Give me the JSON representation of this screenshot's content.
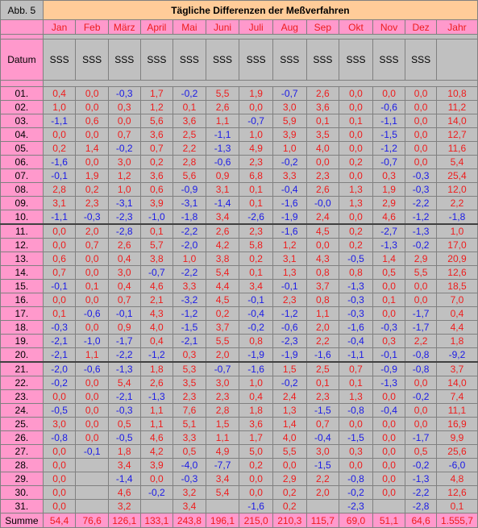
{
  "abb_label": "Abb. 5",
  "title": "Tägliche Differenzen der Meßverfahren",
  "months": [
    "Jan",
    "Feb",
    "März",
    "April",
    "Mai",
    "Juni",
    "Juli",
    "Aug",
    "Sep",
    "Okt",
    "Nov",
    "Dez",
    "Jahr"
  ],
  "datum_label": "Datum",
  "sss_values": [
    "SSS",
    "SSS",
    "SSS",
    "SSS",
    "SSS",
    "SSS",
    "SSS",
    "SSS",
    "SSS",
    "SSS",
    "SSS",
    "SSS",
    ""
  ],
  "rows": [
    {
      "day": "01.",
      "v": [
        "0,4",
        "0,0",
        "-0,3",
        "1,7",
        "-0,2",
        "5,5",
        "1,9",
        "-0,7",
        "2,6",
        "0,0",
        "0,0",
        "0,0",
        "10,8"
      ]
    },
    {
      "day": "02.",
      "v": [
        "1,0",
        "0,0",
        "0,3",
        "1,2",
        "0,1",
        "2,6",
        "0,0",
        "3,0",
        "3,6",
        "0,0",
        "-0,6",
        "0,0",
        "11,2"
      ]
    },
    {
      "day": "03.",
      "v": [
        "-1,1",
        "0,6",
        "0,0",
        "5,6",
        "3,6",
        "1,1",
        "-0,7",
        "5,9",
        "0,1",
        "0,1",
        "-1,1",
        "0,0",
        "14,0"
      ]
    },
    {
      "day": "04.",
      "v": [
        "0,0",
        "0,0",
        "0,7",
        "3,6",
        "2,5",
        "-1,1",
        "1,0",
        "3,9",
        "3,5",
        "0,0",
        "-1,5",
        "0,0",
        "12,7"
      ]
    },
    {
      "day": "05.",
      "v": [
        "0,2",
        "1,4",
        "-0,2",
        "0,7",
        "2,2",
        "-1,3",
        "4,9",
        "1,0",
        "4,0",
        "0,0",
        "-1,2",
        "0,0",
        "11,6"
      ]
    },
    {
      "day": "06.",
      "v": [
        "-1,6",
        "0,0",
        "3,0",
        "0,2",
        "2,8",
        "-0,6",
        "2,3",
        "-0,2",
        "0,0",
        "0,2",
        "-0,7",
        "0,0",
        "5,4"
      ]
    },
    {
      "day": "07.",
      "v": [
        "-0,1",
        "1,9",
        "1,2",
        "3,6",
        "5,6",
        "0,9",
        "6,8",
        "3,3",
        "2,3",
        "0,0",
        "0,3",
        "-0,3",
        "25,4"
      ]
    },
    {
      "day": "08.",
      "v": [
        "2,8",
        "0,2",
        "1,0",
        "0,6",
        "-0,9",
        "3,1",
        "0,1",
        "-0,4",
        "2,6",
        "1,3",
        "1,9",
        "-0,3",
        "12,0"
      ]
    },
    {
      "day": "09.",
      "v": [
        "3,1",
        "2,3",
        "-3,1",
        "3,9",
        "-3,1",
        "-1,4",
        "0,1",
        "-1,6",
        "-0,0",
        "1,3",
        "2,9",
        "-2,2",
        "2,2"
      ]
    },
    {
      "day": "10.",
      "v": [
        "-1,1",
        "-0,3",
        "-2,3",
        "-1,0",
        "-1,8",
        "3,4",
        "-2,6",
        "-1,9",
        "2,4",
        "0,0",
        "4,6",
        "-1,2",
        "-1,8"
      ]
    },
    {
      "day": "11.",
      "v": [
        "0,0",
        "2,0",
        "-2,8",
        "0,1",
        "-2,2",
        "2,6",
        "2,3",
        "-1,6",
        "4,5",
        "0,2",
        "-2,7",
        "-1,3",
        "1,0"
      ]
    },
    {
      "day": "12.",
      "v": [
        "0,0",
        "0,7",
        "2,6",
        "5,7",
        "-2,0",
        "4,2",
        "5,8",
        "1,2",
        "0,0",
        "0,2",
        "-1,3",
        "-0,2",
        "17,0"
      ]
    },
    {
      "day": "13.",
      "v": [
        "0,6",
        "0,0",
        "0,4",
        "3,8",
        "1,0",
        "3,8",
        "0,2",
        "3,1",
        "4,3",
        "-0,5",
        "1,4",
        "2,9",
        "20,9"
      ]
    },
    {
      "day": "14.",
      "v": [
        "0,7",
        "0,0",
        "3,0",
        "-0,7",
        "-2,2",
        "5,4",
        "0,1",
        "1,3",
        "0,8",
        "0,8",
        "0,5",
        "5,5",
        "12,6"
      ]
    },
    {
      "day": "15.",
      "v": [
        "-0,1",
        "0,1",
        "0,4",
        "4,6",
        "3,3",
        "4,4",
        "3,4",
        "-0,1",
        "3,7",
        "-1,3",
        "0,0",
        "0,0",
        "18,5"
      ]
    },
    {
      "day": "16.",
      "v": [
        "0,0",
        "0,0",
        "0,7",
        "2,1",
        "-3,2",
        "4,5",
        "-0,1",
        "2,3",
        "0,8",
        "-0,3",
        "0,1",
        "0,0",
        "7,0"
      ]
    },
    {
      "day": "17.",
      "v": [
        "0,1",
        "-0,6",
        "-0,1",
        "4,3",
        "-1,2",
        "0,2",
        "-0,4",
        "-1,2",
        "1,1",
        "-0,3",
        "0,0",
        "-1,7",
        "0,4"
      ]
    },
    {
      "day": "18.",
      "v": [
        "-0,3",
        "0,0",
        "0,9",
        "4,0",
        "-1,5",
        "3,7",
        "-0,2",
        "-0,6",
        "2,0",
        "-1,6",
        "-0,3",
        "-1,7",
        "4,4"
      ]
    },
    {
      "day": "19.",
      "v": [
        "-2,1",
        "-1,0",
        "-1,7",
        "0,4",
        "-2,1",
        "5,5",
        "0,8",
        "-2,3",
        "2,2",
        "-0,4",
        "0,3",
        "2,2",
        "1,8"
      ]
    },
    {
      "day": "20.",
      "v": [
        "-2,1",
        "1,1",
        "-2,2",
        "-1,2",
        "0,3",
        "2,0",
        "-1,9",
        "-1,9",
        "-1,6",
        "-1,1",
        "-0,1",
        "-0,8",
        "-9,2"
      ]
    },
    {
      "day": "21.",
      "v": [
        "-2,0",
        "-0,6",
        "-1,3",
        "1,8",
        "5,3",
        "-0,7",
        "-1,6",
        "1,5",
        "2,5",
        "0,7",
        "-0,9",
        "-0,8",
        "3,7"
      ]
    },
    {
      "day": "22.",
      "v": [
        "-0,2",
        "0,0",
        "5,4",
        "2,6",
        "3,5",
        "3,0",
        "1,0",
        "-0,2",
        "0,1",
        "0,1",
        "-1,3",
        "0,0",
        "14,0"
      ]
    },
    {
      "day": "23.",
      "v": [
        "0,0",
        "0,0",
        "-2,1",
        "-1,3",
        "2,3",
        "2,3",
        "0,4",
        "2,4",
        "2,3",
        "1,3",
        "0,0",
        "-0,2",
        "7,4"
      ]
    },
    {
      "day": "24.",
      "v": [
        "-0,5",
        "0,0",
        "-0,3",
        "1,1",
        "7,6",
        "2,8",
        "1,8",
        "1,3",
        "-1,5",
        "-0,8",
        "-0,4",
        "0,0",
        "11,1"
      ]
    },
    {
      "day": "25.",
      "v": [
        "3,0",
        "0,0",
        "0,5",
        "1,1",
        "5,1",
        "1,5",
        "3,6",
        "1,4",
        "0,7",
        "0,0",
        "0,0",
        "0,0",
        "16,9"
      ]
    },
    {
      "day": "26.",
      "v": [
        "-0,8",
        "0,0",
        "-0,5",
        "4,6",
        "3,3",
        "1,1",
        "1,7",
        "4,0",
        "-0,4",
        "-1,5",
        "0,0",
        "-1,7",
        "9,9"
      ]
    },
    {
      "day": "27.",
      "v": [
        "0,0",
        "-0,1",
        "1,8",
        "4,2",
        "0,5",
        "4,9",
        "5,0",
        "5,5",
        "3,0",
        "0,3",
        "0,0",
        "0,5",
        "25,6"
      ]
    },
    {
      "day": "28.",
      "v": [
        "0,0",
        "",
        "3,4",
        "3,9",
        "-4,0",
        "-7,7",
        "0,2",
        "0,0",
        "-1,5",
        "0,0",
        "0,0",
        "-0,2",
        "-6,0"
      ]
    },
    {
      "day": "29.",
      "v": [
        "0,0",
        "",
        "-1,4",
        "0,0",
        "-0,3",
        "3,4",
        "0,0",
        "2,9",
        "2,2",
        "-0,8",
        "0,0",
        "-1,3",
        "4,8"
      ]
    },
    {
      "day": "30.",
      "v": [
        "0,0",
        "",
        "4,6",
        "-0,2",
        "3,2",
        "5,4",
        "0,0",
        "0,2",
        "2,0",
        "-0,2",
        "0,0",
        "-2,2",
        "12,6"
      ]
    },
    {
      "day": "31.",
      "v": [
        "0,0",
        "",
        "3,2",
        "",
        "3,4",
        "",
        "-1,6",
        "0,2",
        "",
        "-2,3",
        "",
        "-2,8",
        "0,1"
      ]
    }
  ],
  "summe_label": "Summe",
  "summe": [
    "54,4",
    "76,6",
    "126,1",
    "133,1",
    "243,8",
    "196,1",
    "215,0",
    "210,3",
    "115,7",
    "69,0",
    "51,1",
    "64,6",
    "1.555,7"
  ],
  "colors": {
    "positive": "#ee1c1c",
    "negative": "#1a1ae6",
    "header_bg": "#ff99cc",
    "title_bg": "#ffcc99",
    "cell_bg": "#c0c0c0"
  }
}
